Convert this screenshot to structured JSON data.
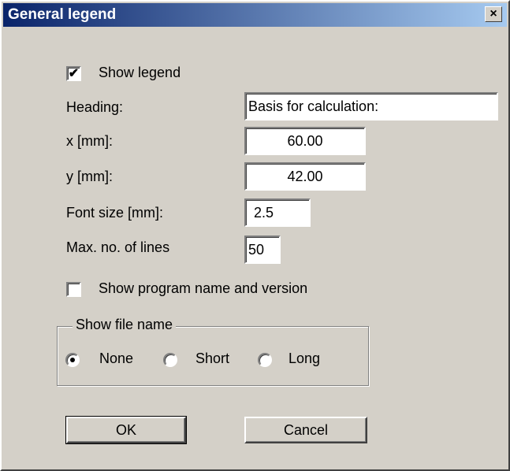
{
  "window": {
    "title": "General legend",
    "close_glyph": "×"
  },
  "show_legend": {
    "label": "Show legend",
    "checked": true,
    "check_glyph": "✔"
  },
  "heading": {
    "label": "Heading:",
    "value": "Basis for calculation:"
  },
  "x_mm": {
    "label": "x [mm]:",
    "value": "60.00"
  },
  "y_mm": {
    "label": "y [mm]:",
    "value": "42.00"
  },
  "font_size": {
    "label": "Font size [mm]:",
    "value": "2.5"
  },
  "max_lines": {
    "label": "Max. no. of lines",
    "value": "50"
  },
  "show_program": {
    "label": "Show program name and version",
    "checked": false
  },
  "file_name_group": {
    "title": "Show file name",
    "options": [
      {
        "label": "None",
        "selected": true
      },
      {
        "label": "Short",
        "selected": false
      },
      {
        "label": "Long",
        "selected": false
      }
    ]
  },
  "buttons": {
    "ok": "OK",
    "cancel": "Cancel"
  },
  "colors": {
    "dialog_bg": "#d4d0c8",
    "title_start": "#0a246a",
    "title_end": "#a6caf0"
  },
  "icons": {
    "close": "close-icon",
    "check": "checkmark-icon",
    "radio_dot": "radio-dot-icon"
  }
}
